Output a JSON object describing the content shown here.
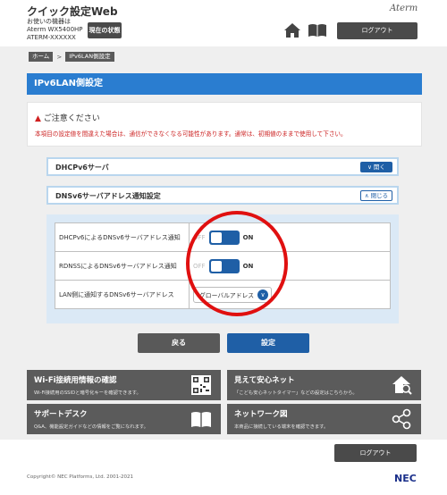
{
  "header": {
    "app_title": "クイック設定Web",
    "device_caption": "お使いの機器は",
    "device_model": "Aterm  WX5400HP",
    "device_serial": "ATERM-XXXXXX",
    "status_button": "現在の状態",
    "brand": "Aterm",
    "logout_label": "ログアウト"
  },
  "breadcrumb": [
    "ホーム",
    ">",
    "IPv6LAN側設定"
  ],
  "page_title": "IPv6LAN側設定",
  "warning": {
    "title": "ご注意ください",
    "icon": "▲",
    "text": "本項目の設定値を間違えた場合は、通信ができなくなる可能性があります。通常は、初期値のままで使用して下さい。"
  },
  "sections": [
    {
      "label": "DHCPv6サーバ",
      "button": "開く"
    },
    {
      "label": "DNSv6サーバアドレス通知設定",
      "button": "閉じる"
    }
  ],
  "settings": [
    {
      "label": "DHCPv6によるDNSv6サーバアドレス通知",
      "off": "OFF",
      "on": "ON"
    },
    {
      "label": "RDNSSによるDNSv6サーバアドレス通知",
      "off": "OFF",
      "on": "ON"
    },
    {
      "label": "LAN側に通知するDNSv6サーバアドレス",
      "value": "グローバルアドレス"
    }
  ],
  "actions": {
    "back": "戻る",
    "set": "設定"
  },
  "tiles": [
    {
      "title": "Wi-Fi接続用情報の確認",
      "desc": "Wi-Fi接続用のSSIDと暗号化キーを確認できます。"
    },
    {
      "title": "見えて安心ネット",
      "desc": "「こども安心ネットタイマー」などの設定はこちらから。"
    },
    {
      "title": "サポートデスク",
      "desc": "Q&A、機能設定ガイドなどの情報をご覧になれます。"
    },
    {
      "title": "ネットワーク図",
      "desc": "本商品に接続している端末を確認できます。"
    }
  ],
  "footer": {
    "logout_label": "ログアウト",
    "copyright": "Copyright© NEC Platforms, Ltd. 2001-2021",
    "logo": "NEC"
  },
  "colors": {
    "accent": "#2a7dd0",
    "button_blue": "#1f5fa6",
    "dark_button": "#4a4a4a",
    "warning_red": "#cc2222",
    "highlight_circle": "#e01010"
  }
}
